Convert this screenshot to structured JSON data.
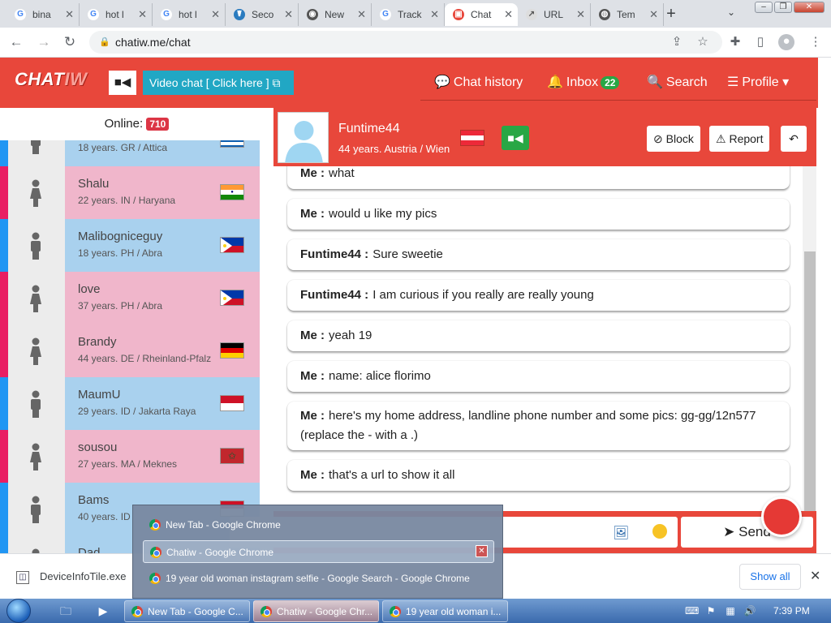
{
  "browser": {
    "tabs": [
      {
        "label": "bina",
        "icon": "G",
        "color": "#4285f4",
        "bg": "#fff"
      },
      {
        "label": "hot l",
        "icon": "G",
        "color": "#4285f4",
        "bg": "#fff"
      },
      {
        "label": "hot l",
        "icon": "G",
        "color": "#4285f4",
        "bg": "#fff"
      },
      {
        "label": "Seco",
        "icon": "☤",
        "color": "#fff",
        "bg": "#2a7bbf"
      },
      {
        "label": "New",
        "icon": "◉",
        "color": "#fff",
        "bg": "#555"
      },
      {
        "label": "Track",
        "icon": "G",
        "color": "#4285f4",
        "bg": "#fff"
      },
      {
        "label": "Chat",
        "icon": "▣",
        "color": "#fff",
        "bg": "#e8473b"
      },
      {
        "label": "URL",
        "icon": "↗",
        "color": "#555",
        "bg": "#ddd"
      },
      {
        "label": "Tem",
        "icon": "◍",
        "color": "#fff",
        "bg": "#555"
      }
    ],
    "new_tab": "+",
    "tab_menu": "⌄",
    "url": "chatiw.me/chat",
    "lock": "🔒"
  },
  "site": {
    "logo_main": "CHAT",
    "logo_accent": "IW",
    "video_chat": "Video chat  [ Click here ]",
    "nav": {
      "chat_history": "Chat history",
      "inbox": "Inbox",
      "inbox_count": "22",
      "search": "Search",
      "profile": "Profile"
    }
  },
  "online": {
    "label": "Online:",
    "count": "710"
  },
  "users": [
    {
      "name": "",
      "meta": "18 years. GR / Attica",
      "gender": "male",
      "flag": "gr"
    },
    {
      "name": "Shalu",
      "meta": "22 years. IN / Haryana",
      "gender": "female",
      "flag": "in"
    },
    {
      "name": "Malibogniceguy",
      "meta": "18 years. PH / Abra",
      "gender": "male",
      "flag": "ph"
    },
    {
      "name": "love",
      "meta": "37 years. PH / Abra",
      "gender": "female",
      "flag": "ph"
    },
    {
      "name": "Brandy",
      "meta": "44 years. DE / Rheinland-Pfalz",
      "gender": "female",
      "flag": "de"
    },
    {
      "name": "MaumU",
      "meta": "29 years. ID / Jakarta Raya",
      "gender": "male",
      "flag": "id"
    },
    {
      "name": "sousou",
      "meta": "27 years. MA / Meknes",
      "gender": "female",
      "flag": "ma"
    },
    {
      "name": "Bams",
      "meta": "40 years. ID",
      "gender": "male",
      "flag": "id"
    },
    {
      "name": "Dad",
      "meta": "",
      "gender": "male",
      "flag": ""
    }
  ],
  "partner": {
    "name": "Funtime44",
    "meta": "44 years. Austria / Wien",
    "block": "Block",
    "report": "Report"
  },
  "messages": [
    {
      "sender": "Me :",
      "text": "what"
    },
    {
      "sender": "Me :",
      "text": "would u like my pics"
    },
    {
      "sender": "Funtime44 :",
      "text": "Sure sweetie"
    },
    {
      "sender": "Funtime44 :",
      "text": "I am curious if you really are really young"
    },
    {
      "sender": "Me :",
      "text": "yeah 19"
    },
    {
      "sender": "Me :",
      "text": "name: alice florimo"
    },
    {
      "sender": "Me :",
      "text": "here's my home address, landline phone number and some pics: gg-gg/12n577 (replace the - with a .)"
    },
    {
      "sender": "Me :",
      "text": "that's a url to show it all"
    }
  ],
  "composer": {
    "send": "Send"
  },
  "popup": {
    "items": [
      "New Tab - Google Chrome",
      "Chatiw - Google Chrome",
      "19 year old woman instagram selfie - Google Search - Google Chrome"
    ]
  },
  "download": {
    "filename": "DeviceInfoTile.exe",
    "show_all": "Show all"
  },
  "taskbar": {
    "tasks": [
      "New Tab - Google C...",
      "Chatiw - Google Chr...",
      "19 year old woman i..."
    ],
    "clock": "7:39 PM"
  },
  "colors": {
    "brand": "#e8473b",
    "video": "#21a7c4",
    "badge_green": "#28a745",
    "badge_red": "#dc3545"
  }
}
